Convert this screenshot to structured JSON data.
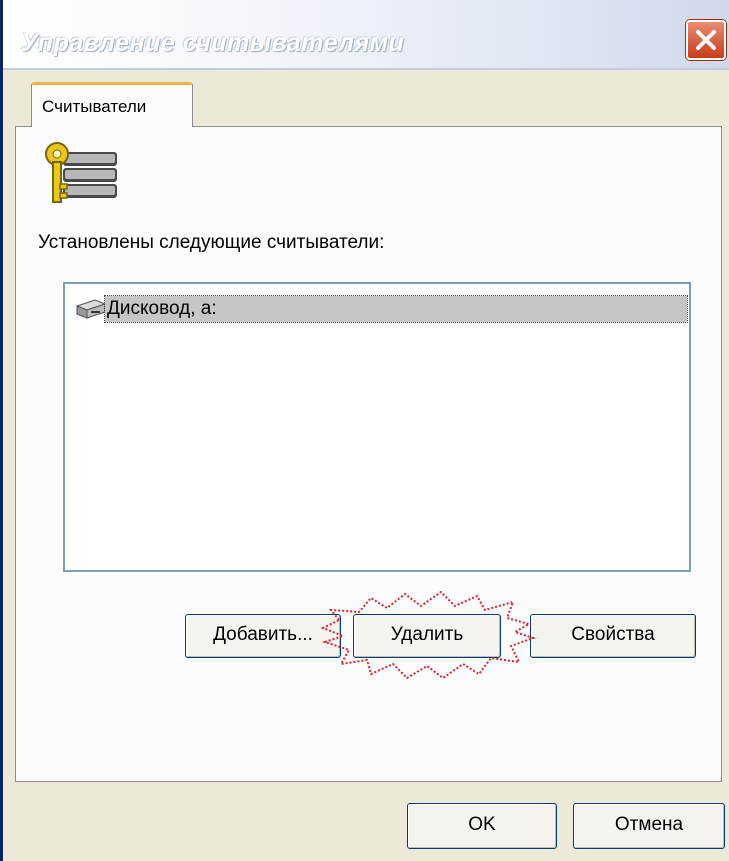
{
  "window": {
    "title": "Управление считывателями"
  },
  "tabs": [
    {
      "label": "Считыватели"
    }
  ],
  "panel": {
    "installed_label": "Установлены следующие считыватели:",
    "readers": [
      {
        "label": "Дисковод, а:",
        "selected": true,
        "icon": "floppy-drive-icon"
      }
    ],
    "header_icon": "key-database-icon"
  },
  "buttons": {
    "add": "Добавить...",
    "delete": "Удалить",
    "properties": "Свойства",
    "ok": "OK",
    "cancel": "Отмена"
  },
  "colors": {
    "selection": "#c6c6c6",
    "highlight_marker": "#e0202a",
    "close_button": "#c93b1b"
  }
}
